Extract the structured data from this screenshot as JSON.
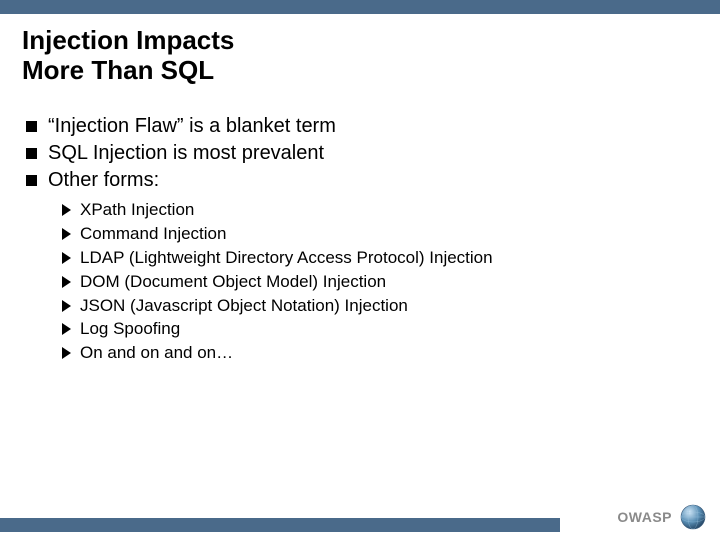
{
  "title_line1": "Injection Impacts",
  "title_line2": "More Than SQL",
  "bullets": [
    "“Injection Flaw” is a blanket term",
    "SQL Injection is most prevalent",
    "Other forms:"
  ],
  "sub_bullets": [
    "XPath Injection",
    "Command Injection",
    "LDAP (Lightweight Directory Access Protocol) Injection",
    "DOM (Document Object Model) Injection",
    "JSON (Javascript Object Notation) Injection",
    "Log Spoofing",
    "On and on and on…"
  ],
  "footer_text": "OWASP",
  "colors": {
    "bar": "#4a6a8a",
    "footer_text": "#8a8a8a"
  }
}
